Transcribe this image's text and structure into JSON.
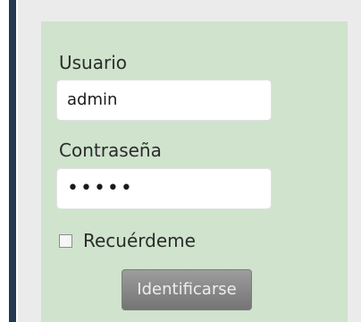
{
  "login": {
    "username_label": "Usuario",
    "username_value": "admin",
    "password_label": "Contraseña",
    "password_value": "•••••",
    "remember_label": "Recuérdeme",
    "remember_checked": false,
    "submit_label": "Identificarse"
  },
  "colors": {
    "panel": "#cfe3cd",
    "sidebar_stripe": "#263952",
    "button": "#8a8a8a"
  }
}
